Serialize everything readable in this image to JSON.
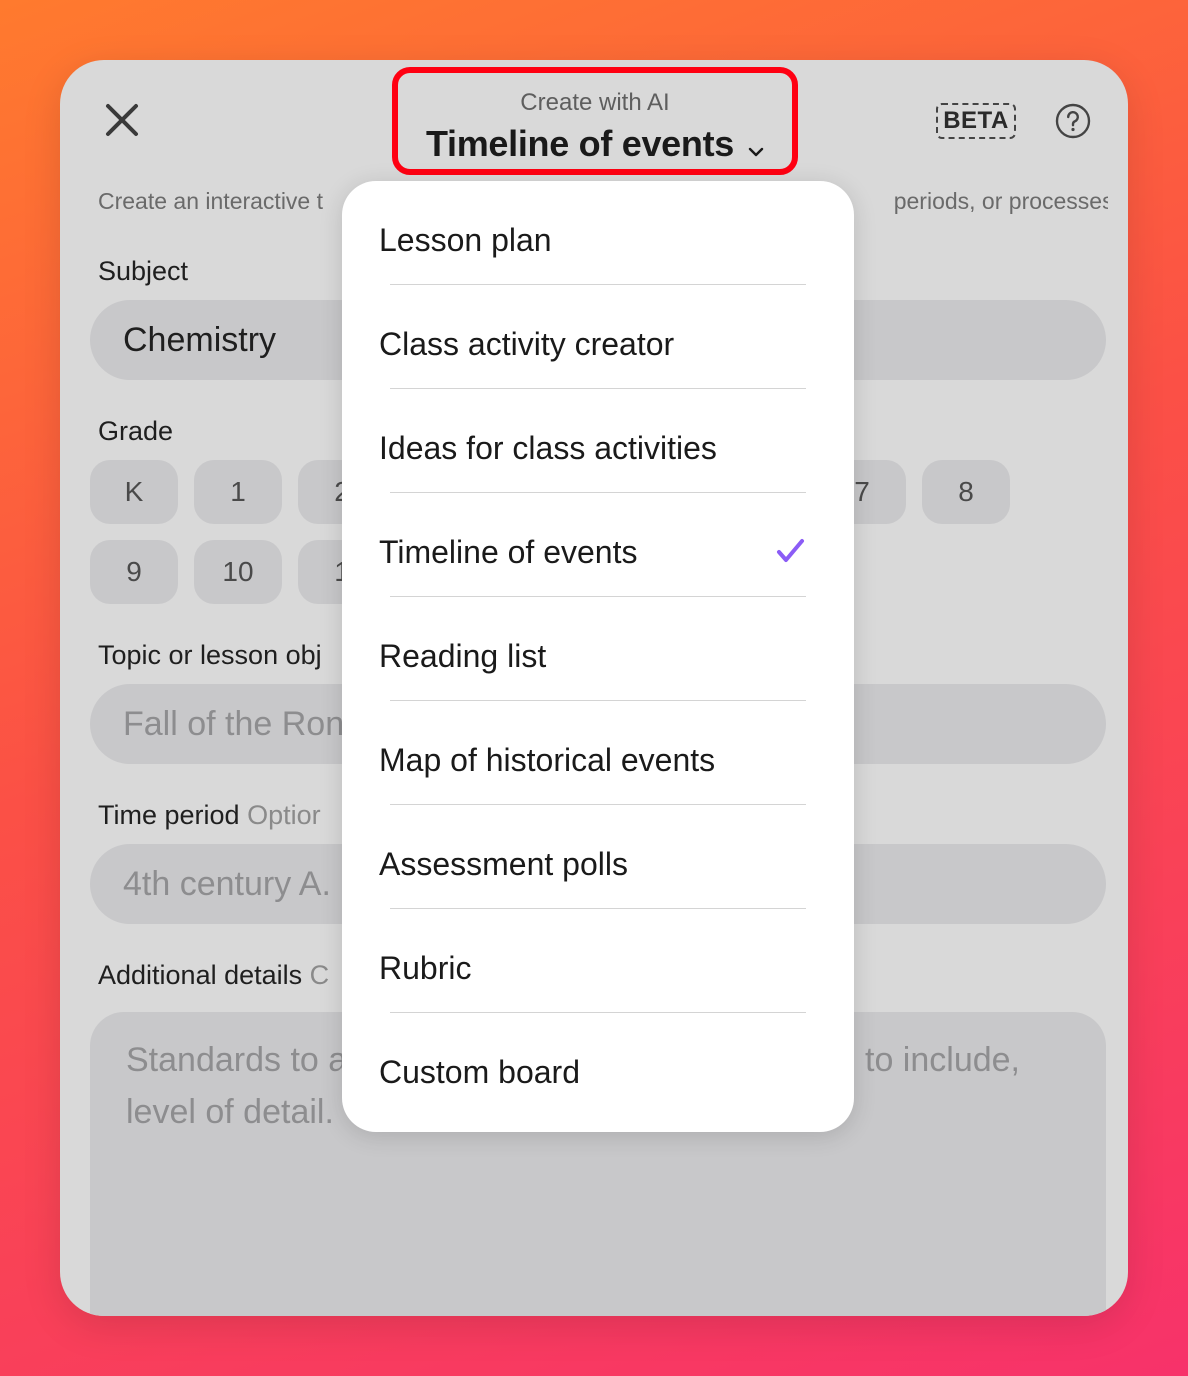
{
  "header": {
    "subtitle": "Create with AI",
    "title": "Timeline of events",
    "beta_label": "BETA"
  },
  "description": {
    "left": "Create an interactive t",
    "right": "periods, or processes."
  },
  "form": {
    "subject_label": "Subject",
    "subject_value": "Chemistry",
    "grade_label": "Grade",
    "grades_row1": [
      "K",
      "1",
      "2",
      "7",
      "8"
    ],
    "grades_row2": [
      "9",
      "10",
      "1"
    ],
    "topic_label": "Topic or lesson obj",
    "topic_placeholder": "Fall of the Ron",
    "time_label": "Time period",
    "time_optional": "Optior",
    "time_placeholder": "4th century A.",
    "details_label": "Additional details",
    "details_optional": "C",
    "details_placeholder_line1": "Standards to a",
    "details_placeholder_line1_right": "to include,",
    "details_placeholder_line2": "level of detail."
  },
  "menu": {
    "selected": "Timeline of events",
    "items": [
      "Lesson plan",
      "Class activity creator",
      "Ideas for class activities",
      "Timeline of events",
      "Reading list",
      "Map of historical events",
      "Assessment polls",
      "Rubric",
      "Custom board"
    ]
  },
  "colors": {
    "highlight_border": "#ff0012",
    "check": "#8b5cf6"
  }
}
